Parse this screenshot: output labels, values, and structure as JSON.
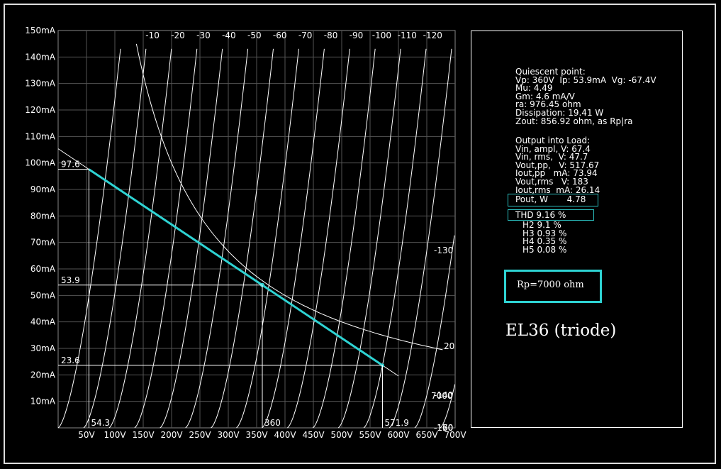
{
  "chart_data": {
    "type": "line",
    "xlabel": "",
    "ylabel": "",
    "xlim": [
      0,
      700
    ],
    "ylim": [
      0,
      150
    ],
    "x_ticks": [
      "50V",
      "100V",
      "150V",
      "200V",
      "250V",
      "300V",
      "350V",
      "400V",
      "450V",
      "500V",
      "550V",
      "600V",
      "650V",
      "700V"
    ],
    "y_ticks": [
      "10mA",
      "20mA",
      "30mA",
      "40mA",
      "50mA",
      "60mA",
      "70mA",
      "80mA",
      "90mA",
      "100mA",
      "110mA",
      "120mA",
      "130mA",
      "140mA",
      "150mA"
    ],
    "grid": true,
    "grid_curve_labels": [
      "-10",
      "-20",
      "-30",
      "-40",
      "-50",
      "-60",
      "-70",
      "-80",
      "-90",
      "-100",
      "-110",
      "-120",
      "-130",
      "-140",
      "-150",
      "-160",
      "-170"
    ],
    "dissipation_curve_label": "20",
    "load_curve_label": "7000",
    "load_line": {
      "x": [
        54.3,
        360,
        571.9
      ],
      "y": [
        97.6,
        53.9,
        23.6
      ],
      "color": "#2ed3d3"
    },
    "markers": {
      "y_values": [
        "97.6",
        "53.9",
        "23.6"
      ],
      "x_values": [
        "54.3",
        "360",
        "571.9"
      ]
    }
  },
  "info": {
    "quiescent_title": "Quiescent point:",
    "vp_line": "Vp: 360V  Ip: 53.9mA  Vg: -67.4V",
    "mu": "Mu: 4.49",
    "gm": "Gm: 4.6 mA/V",
    "ra": "ra: 976.45 ohm",
    "dissipation": "Dissipation: 19.41 W",
    "zout": "Zout: 856.92 ohm, as Rp|ra",
    "output_title": "Output into Load:",
    "vin_ampl": "Vin, ampl, V: 67.4",
    "vin_rms": "Vin, rms,  V: 47.7",
    "vout_pp": "Vout,pp,   V: 517.67",
    "iout_pp": "Iout,pp   mA: 73.94",
    "vout_rms": "Vout,rms   V: 183",
    "iout_rms": "Iout,rms  mA: 26.14",
    "pout": "Pout, W       4.78",
    "thd": "THD 9.16 %",
    "h2": "H2 9.1 %",
    "h3": "H3 0.93 %",
    "h4": "H4 0.35 %",
    "h5": "H5 0.08 %",
    "rp_label": "Rp=7000 ohm",
    "tube_name": "EL36 (triode)"
  },
  "colors": {
    "accent": "#2ed3d3",
    "curves": "#ffffff",
    "grid": "#555555",
    "background": "#000000"
  }
}
